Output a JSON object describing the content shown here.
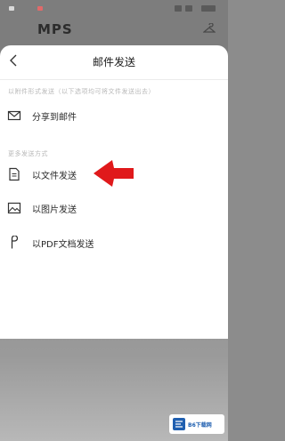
{
  "status_bar": {
    "left_dots": [
      {
        "color": "#d9d9d9"
      },
      {
        "color": "#e06a6a"
      }
    ]
  },
  "background_app": {
    "logo_text": "MPS"
  },
  "sheet": {
    "title": "邮件发送",
    "back_icon": "chevron-left-icon",
    "sections": [
      {
        "label": "以附件形式发送（以下选项均可将文件发送出去）",
        "items": [
          {
            "label": "分享到邮件",
            "icon": "mail-icon"
          }
        ]
      },
      {
        "label": "更多发送方式",
        "items": [
          {
            "label": "以文件发送",
            "icon": "file-icon"
          },
          {
            "label": "以图片发送",
            "icon": "image-icon"
          },
          {
            "label": "以PDF文档发送",
            "icon": "pdf-icon"
          }
        ]
      }
    ]
  },
  "annotation": {
    "arrow_color": "#e0191b",
    "points_to": "以文件发送"
  },
  "watermark": {
    "text": "B6下载网"
  },
  "colors": {
    "accent_red": "#e0191b",
    "sheet_bg": "#ffffff",
    "overlay": "#8c8c8c"
  }
}
